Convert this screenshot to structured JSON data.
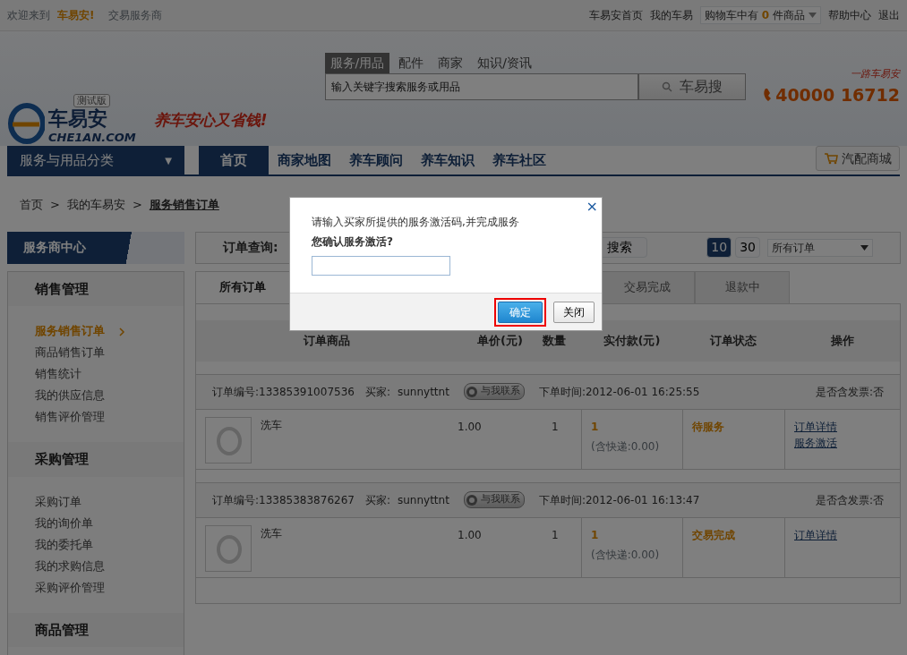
{
  "top_bar": {
    "welcome": "欢迎来到",
    "site": "车易安!",
    "role": "交易服务商",
    "links": [
      "车易安首页",
      "我的车易"
    ],
    "cart": {
      "prefix": "购物车中有",
      "count": "0",
      "suffix": "件商品"
    },
    "links_right": [
      "帮助中心",
      "退出"
    ]
  },
  "header": {
    "logo_name": "车易安",
    "logo_domain": "CHE1AN.COM",
    "beta_badge": "测试版",
    "slogan": "养车安心又省钱!",
    "search_tabs": [
      {
        "label": "服务/用品",
        "selected": true
      },
      {
        "label": "配件",
        "selected": false
      },
      {
        "label": "商家",
        "selected": false
      },
      {
        "label": "知识/资讯",
        "selected": false
      }
    ],
    "search_value": "输入关键字搜索服务或用品",
    "search_button": "车易搜",
    "hotline_caption": "一路车易安",
    "hotline": "40000 16712"
  },
  "nav": {
    "category": "服务与用品分类",
    "category_caret": "▼",
    "items": [
      {
        "label": "首页",
        "selected": true
      },
      {
        "label": "商家地图",
        "selected": false
      },
      {
        "label": "养车顾问",
        "selected": false
      },
      {
        "label": "养车知识",
        "selected": false
      },
      {
        "label": "养车社区",
        "selected": false
      }
    ],
    "mall_button": "汽配商城"
  },
  "breadcrumb": [
    "首页",
    "我的车易安",
    "服务销售订单"
  ],
  "breadcrumb_sep": ">",
  "sidebar": {
    "title": "服务商中心",
    "groups": [
      {
        "title": "销售管理",
        "items": [
          {
            "label": "服务销售订单",
            "selected": true
          },
          {
            "label": "商品销售订单",
            "selected": false
          },
          {
            "label": "销售统计",
            "selected": false
          },
          {
            "label": "我的供应信息",
            "selected": false
          },
          {
            "label": "销售评价管理",
            "selected": false
          }
        ]
      },
      {
        "title": "采购管理",
        "items": [
          {
            "label": "采购订单",
            "selected": false
          },
          {
            "label": "我的询价单",
            "selected": false
          },
          {
            "label": "我的委托单",
            "selected": false
          },
          {
            "label": "我的求购信息",
            "selected": false
          },
          {
            "label": "采购评价管理",
            "selected": false
          }
        ]
      },
      {
        "title": "商品管理"
      }
    ]
  },
  "query": {
    "label": "订单查询:",
    "search_button": "搜索",
    "page_sizes": [
      {
        "label": "10",
        "selected": true
      },
      {
        "label": "30",
        "selected": false
      }
    ],
    "filter": "所有订单"
  },
  "order_tabs": [
    {
      "label": "所有订单",
      "selected": true
    },
    {
      "label": "交易完成",
      "selected": false
    },
    {
      "label": "退款中",
      "selected": false
    }
  ],
  "columns": [
    "订单商品",
    "单价(元)",
    "数量",
    "实付款(元)",
    "订单状态",
    "操作"
  ],
  "orders": [
    {
      "number_label": "订单编号:",
      "number": "13385391007536",
      "buyer_label": "买家:",
      "buyer": "sunnyttnt",
      "contact": "与我联系",
      "time_label": "下单时间:",
      "time": "2012-06-01 16:25:55",
      "invoice": "是否含发票:否",
      "item": "洗车",
      "price": "1.00",
      "qty": "1",
      "paid": "1",
      "shipping": "(含快递:0.00)",
      "status": "待服务",
      "actions": [
        "订单详情",
        "服务激活"
      ]
    },
    {
      "number_label": "订单编号:",
      "number": "13385383876267",
      "buyer_label": "买家:",
      "buyer": "sunnyttnt",
      "contact": "与我联系",
      "time_label": "下单时间:",
      "time": "2012-06-01 16:13:47",
      "invoice": "是否含发票:否",
      "item": "洗车",
      "price": "1.00",
      "qty": "1",
      "paid": "1",
      "shipping": "(含快递:0.00)",
      "status": "交易完成",
      "actions": [
        "订单详情"
      ]
    }
  ],
  "dialog": {
    "close": "×",
    "message": "请输入买家所提供的服务激活码,并完成服务",
    "question": "您确认服务激活?",
    "confirm": "确定",
    "cancel": "关闭",
    "confirm_highlighted": true
  }
}
